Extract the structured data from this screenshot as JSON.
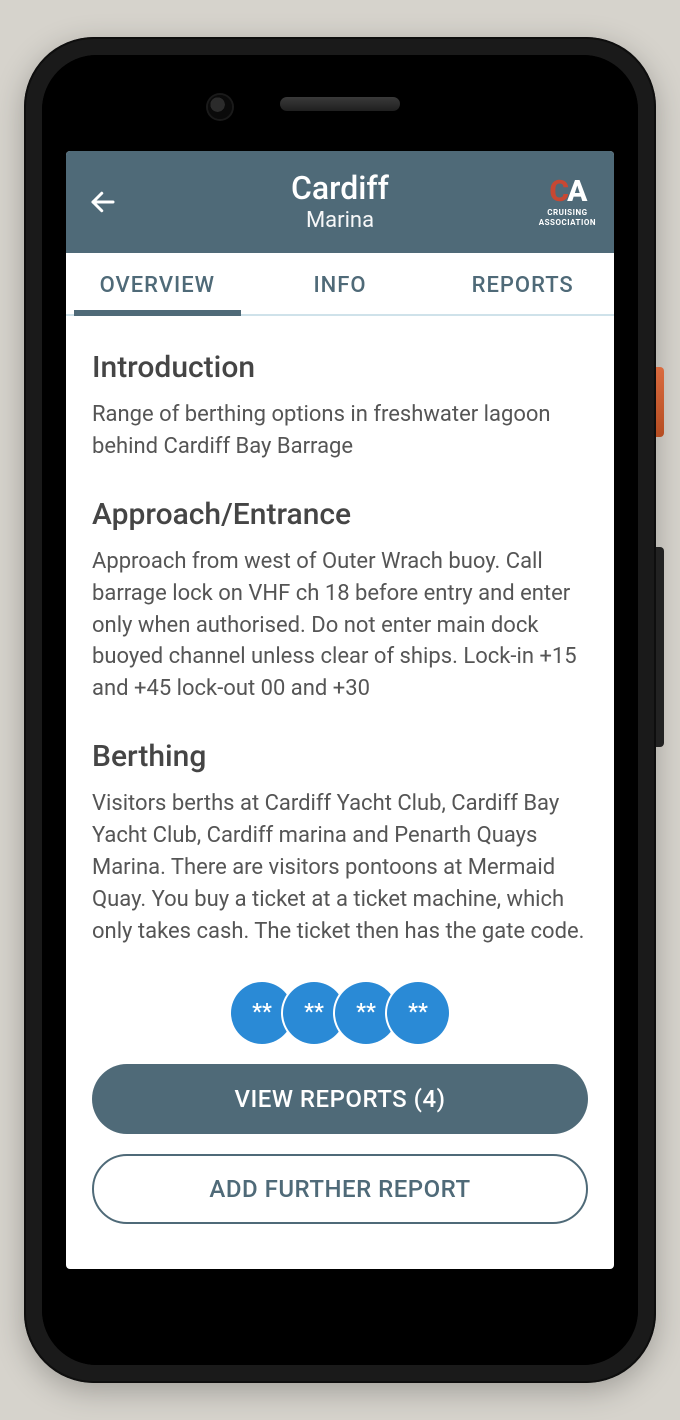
{
  "header": {
    "title": "Cardiff",
    "subtitle": "Marina",
    "logo_line1": "CRUISING",
    "logo_line2": "ASSOCIATION"
  },
  "tabs": {
    "items": [
      {
        "label": "OVERVIEW",
        "active": true
      },
      {
        "label": "INFO",
        "active": false
      },
      {
        "label": "REPORTS",
        "active": false
      }
    ]
  },
  "sections": [
    {
      "heading": "Introduction",
      "body": "Range of berthing options in freshwater lagoon behind Cardiff Bay Barrage"
    },
    {
      "heading": "Approach/Entrance",
      "body": "Approach from west of Outer Wrach buoy. Call barrage lock on VHF ch 18 before entry and enter only when authorised. Do not enter main dock buoyed channel unless clear of ships. Lock-in +15 and +45 lock-out 00 and +30"
    },
    {
      "heading": "Berthing",
      "body": "Visitors berths at Cardiff Yacht Club, Cardiff Bay Yacht Club, Cardiff marina and Penarth Quays Marina. There are visitors pontoons at Mermaid Quay. You buy a ticket at a ticket machine, which only takes cash. The ticket then has the gate code."
    }
  ],
  "reports": {
    "count": 4,
    "dots": [
      "**",
      "**",
      "**",
      "**"
    ]
  },
  "buttons": {
    "view_reports_label": "VIEW REPORTS (4)",
    "add_report_label": "ADD FURTHER REPORT"
  },
  "colors": {
    "header_bg": "#4f6a78",
    "accent_blue": "#2a8ad6",
    "tab_underline": "#4f6a78"
  }
}
